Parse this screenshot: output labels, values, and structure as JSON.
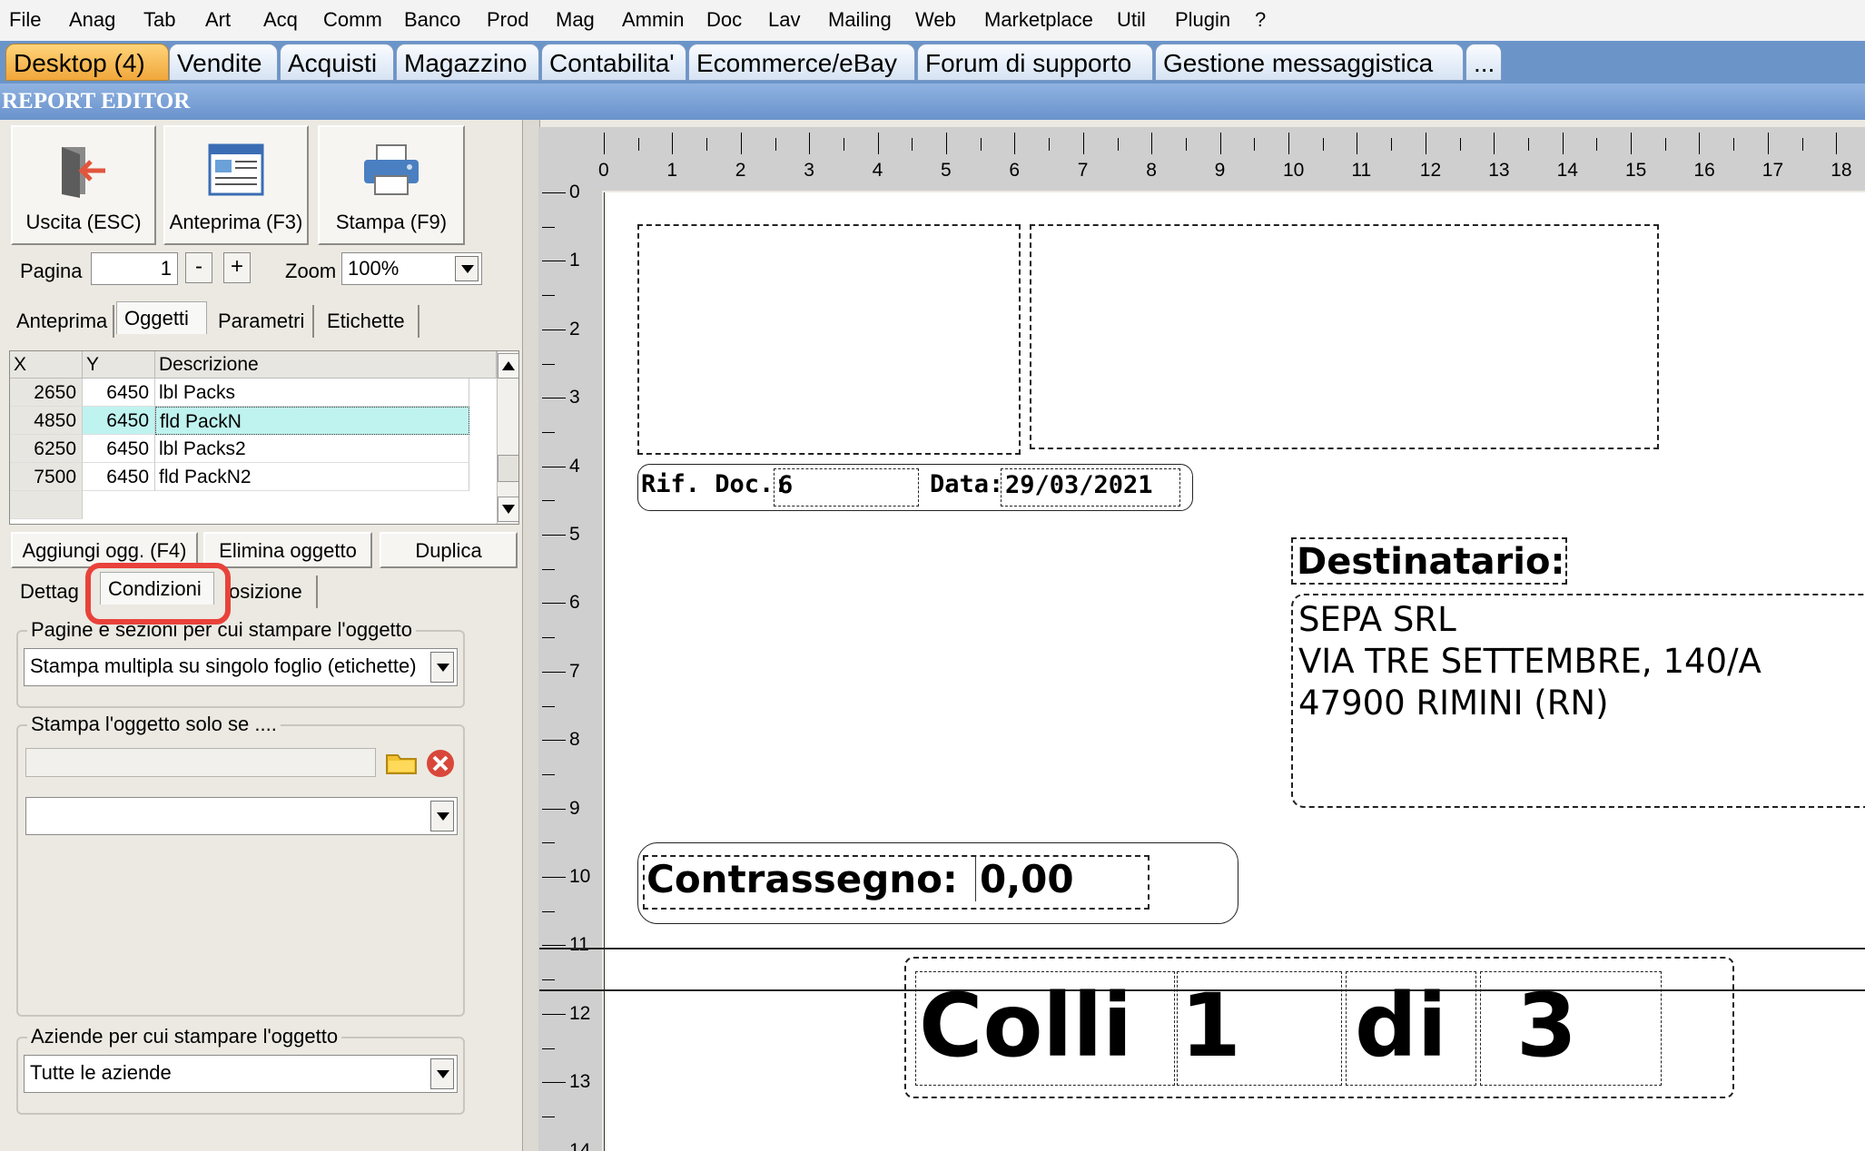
{
  "menu": [
    "File",
    "Anag",
    "Tab",
    "Art",
    "Acq",
    "Comm",
    "Banco",
    "Prod",
    "Mag",
    "Ammin",
    "Doc",
    "Lav",
    "Mailing",
    "Web",
    "Marketplace",
    "Util",
    "Plugin",
    "?"
  ],
  "tabs": [
    "Desktop (4)",
    "Vendite",
    "Acquisti",
    "Magazzino",
    "Contabilita'",
    "Ecommerce/eBay",
    "Forum di supporto",
    "Gestione messaggistica",
    "..."
  ],
  "window_title": "REPORT EDITOR",
  "toolbar": {
    "exit": "Uscita (ESC)",
    "preview": "Anteprima (F3)",
    "print": "Stampa (F9)"
  },
  "pager": {
    "page_label": "Pagina",
    "page_value": "1",
    "minus": "-",
    "plus": "+",
    "zoom_label": "Zoom",
    "zoom_value": "100%"
  },
  "main_tabs": [
    "Anteprima",
    "Oggetti",
    "Parametri",
    "Etichette"
  ],
  "main_tabs_active": "Oggetti",
  "grid": {
    "headers": [
      "X",
      "Y",
      "Descrizione"
    ],
    "rows": [
      {
        "x": "2650",
        "y": "6450",
        "desc": "lbl Packs"
      },
      {
        "x": "4850",
        "y": "6450",
        "desc": "fld PackN"
      },
      {
        "x": "6250",
        "y": "6450",
        "desc": "lbl Packs2"
      },
      {
        "x": "7500",
        "y": "6450",
        "desc": "fld PackN2"
      }
    ],
    "selected_row": 1
  },
  "object_buttons": {
    "add": "Aggiungi ogg. (F4)",
    "delete": "Elimina oggetto",
    "duplicate": "Duplica"
  },
  "sub_tabs": [
    "Dettag",
    "Condizioni",
    "osizione"
  ],
  "sub_tabs_active": "Condizioni",
  "groups": {
    "pages": {
      "title": "Pagine e sezioni per cui stampare l'oggetto",
      "value": "Stampa multipla su singolo foglio (etichette)"
    },
    "condition": {
      "title": "Stampa l'oggetto solo se ....",
      "expression": "",
      "select_value": ""
    },
    "companies": {
      "title": "Aziende per cui stampare l'oggetto",
      "value": "Tutte le aziende"
    }
  },
  "ruler": {
    "h": [
      "0",
      "1",
      "2",
      "3",
      "4",
      "5",
      "6",
      "7",
      "8",
      "9",
      "10",
      "11",
      "12",
      "13",
      "14",
      "15",
      "16",
      "17",
      "18"
    ],
    "v": [
      "0",
      "1",
      "2",
      "3",
      "4",
      "5",
      "6",
      "7",
      "8",
      "9",
      "10",
      "11",
      "12",
      "13",
      "14"
    ]
  },
  "report": {
    "rif_label": "Rif. Doc.:",
    "rif_value": "6",
    "data_label": "Data:",
    "data_value": "29/03/2021",
    "dest_label": "Destinatario:",
    "dest_lines": [
      "SEPA SRL",
      "VIA TRE SETTEMBRE, 140/A",
      "47900 RIMINI (RN)"
    ],
    "contr_label": "Contrassegno:",
    "contr_value": "0,00",
    "colli_label": "Colli",
    "colli_value": "1",
    "di_label": "di",
    "di_value": "3"
  },
  "colors": {
    "tab_strip": "#6b95c9",
    "active_tab": "#f0a73b",
    "title_bar": "#7aa0d4",
    "selected_row": "#bff3ef",
    "highlight": "#e8423a"
  }
}
